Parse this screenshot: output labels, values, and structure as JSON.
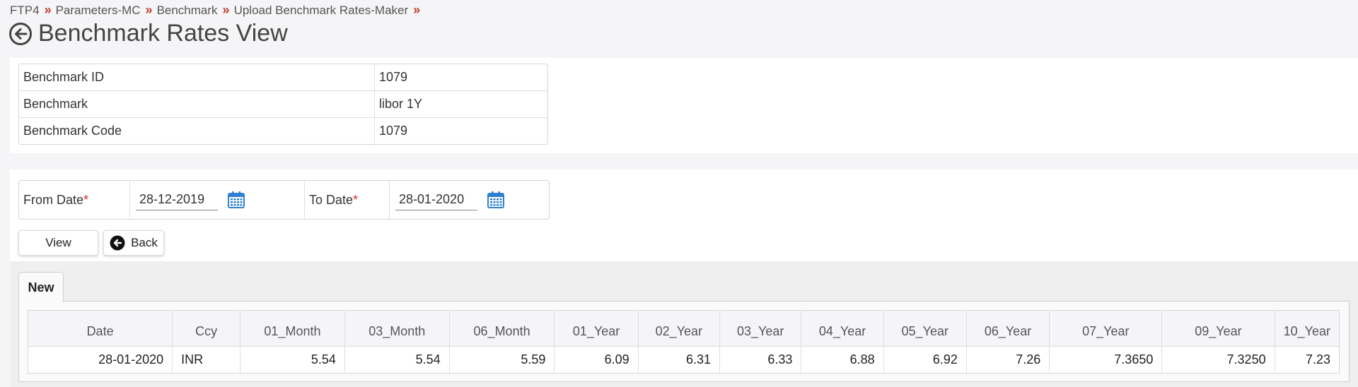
{
  "breadcrumb": [
    "FTP4",
    "Parameters-MC",
    "Benchmark",
    "Upload Benchmark Rates-Maker"
  ],
  "breadcrumb_separator": "»",
  "page_title": "Benchmark Rates View",
  "info": {
    "rows": [
      {
        "label": "Benchmark ID",
        "value": "1079"
      },
      {
        "label": "Benchmark",
        "value": "libor 1Y"
      },
      {
        "label": "Benchmark Code",
        "value": "1079"
      }
    ]
  },
  "filter": {
    "from_label": "From Date",
    "from_value": "28-12-2019",
    "to_label": "To Date",
    "to_value": "28-01-2020",
    "required_mark": "*"
  },
  "buttons": {
    "view": "View",
    "back": "Back"
  },
  "tabs": [
    {
      "label": "New"
    }
  ],
  "table": {
    "headers": [
      "Date",
      "Ccy",
      "01_Month",
      "03_Month",
      "06_Month",
      "01_Year",
      "02_Year",
      "03_Year",
      "04_Year",
      "05_Year",
      "06_Year",
      "07_Year",
      "09_Year",
      "10_Year"
    ],
    "rows": [
      [
        "28-01-2020",
        "INR",
        "5.54",
        "5.54",
        "5.59",
        "6.09",
        "6.31",
        "6.33",
        "6.88",
        "6.92",
        "7.26",
        "7.3650",
        "7.3250",
        "7.23"
      ]
    ]
  },
  "colors": {
    "accent_red": "#c0392b",
    "required_red": "#d32f2f",
    "calendar_blue": "#2f80d1"
  },
  "icons": {
    "title_back": "arrow-left-circle-icon",
    "calendar": "calendar-icon",
    "back_button": "arrow-left-circle-filled-icon"
  }
}
